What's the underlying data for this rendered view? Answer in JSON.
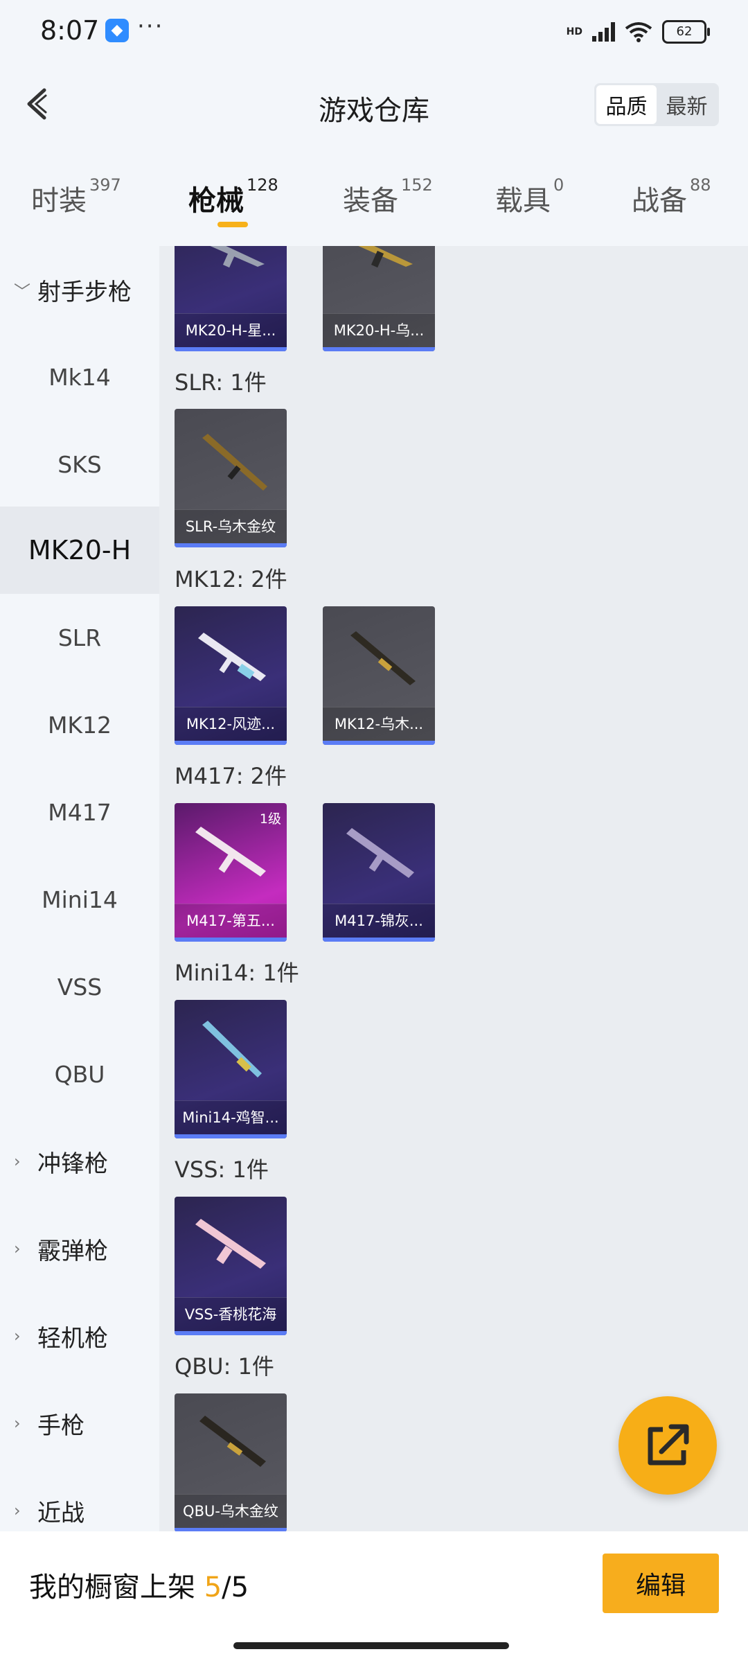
{
  "status_bar": {
    "time": "8:07",
    "app_icon": "app-icon",
    "more": "···",
    "hd": "HD",
    "battery": "62"
  },
  "header": {
    "title": "游戏仓库",
    "sort_options": [
      "品质",
      "最新"
    ],
    "sort_selected": "品质"
  },
  "tabs": [
    {
      "label": "时装",
      "count": "397"
    },
    {
      "label": "枪械",
      "count": "128",
      "active": true
    },
    {
      "label": "装备",
      "count": "152"
    },
    {
      "label": "载具",
      "count": "0"
    },
    {
      "label": "战备",
      "count": "88"
    }
  ],
  "sidebar": {
    "category_open": "射手步枪",
    "subitems": [
      "Mk14",
      "SKS",
      "MK20-H",
      "SLR",
      "MK12",
      "M417",
      "Mini14",
      "VSS",
      "QBU"
    ],
    "selected": "MK20-H",
    "categories": [
      "冲锋枪",
      "霰弹枪",
      "轻机枪",
      "手枪",
      "近战"
    ]
  },
  "content": {
    "groups": [
      {
        "label": "",
        "items": [
          {
            "name": "MK20-H-星...",
            "rarity": "purple"
          },
          {
            "name": "MK20-H-乌...",
            "rarity": "grey"
          }
        ]
      },
      {
        "label": "SLR: 1件",
        "items": [
          {
            "name": "SLR-乌木金纹",
            "rarity": "grey"
          }
        ]
      },
      {
        "label": "MK12: 2件",
        "items": [
          {
            "name": "MK12-风迹...",
            "rarity": "purple"
          },
          {
            "name": "MK12-乌木...",
            "rarity": "grey"
          }
        ]
      },
      {
        "label": "M417: 2件",
        "items": [
          {
            "name": "M417-第五...",
            "rarity": "pink",
            "level": "1级"
          },
          {
            "name": "M417-锦灰...",
            "rarity": "purple"
          }
        ]
      },
      {
        "label": "Mini14: 1件",
        "items": [
          {
            "name": "Mini14-鸡智...",
            "rarity": "purple"
          }
        ]
      },
      {
        "label": "VSS: 1件",
        "items": [
          {
            "name": "VSS-香桃花海",
            "rarity": "purple"
          }
        ]
      },
      {
        "label": "QBU: 1件",
        "items": [
          {
            "name": "QBU-乌木金纹",
            "rarity": "grey"
          }
        ]
      }
    ]
  },
  "share_button": {
    "icon": "share-external-icon"
  },
  "footer": {
    "text_prefix": "我的橱窗上架 ",
    "current": "5",
    "total": "/5",
    "edit_label": "编辑"
  },
  "colors": {
    "accent": "#f7ae17",
    "purple_card": "#3a2f78",
    "grey_card": "#55555c",
    "pink_card": "#c42cbf",
    "card_bar": "#5b7cf5"
  }
}
